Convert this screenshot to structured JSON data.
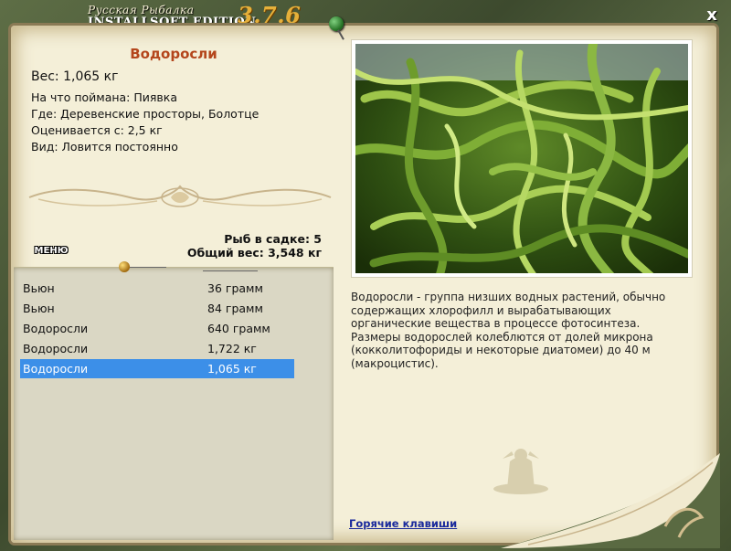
{
  "window": {
    "logo_line1": "Русская Рыбалка",
    "logo_line2": "INSTALLSOFT EDITION",
    "version": "3.7.6",
    "close_label": "x"
  },
  "fish": {
    "name": "Водоросли",
    "weight": "Вес: 1,065 кг",
    "bait": "На что поймана: Пиявка",
    "location": "Где: Деревенские просторы, Болотце",
    "valued_from": "Оценивается с: 2,5 кг",
    "kind": "Вид: Ловится постоянно"
  },
  "cage": {
    "count": "Рыб в садке: 5",
    "total_weight": "Общий вес: 3,548 кг"
  },
  "menu_label": "МЕНЮ",
  "catches": [
    {
      "name": "Вьюн",
      "weight": "36 грамм"
    },
    {
      "name": "Вьюн",
      "weight": "84 грамм"
    },
    {
      "name": "Водоросли",
      "weight": "640 грамм"
    },
    {
      "name": "Водоросли",
      "weight": "1,722 кг"
    },
    {
      "name": "Водоросли",
      "weight": "1,065 кг",
      "selected": true
    }
  ],
  "description": "Водоросли - группа низших водных растений, обычно содержащих хлорофилл и вырабатывающих органические вещества в процессе фотосинтеза. Размеры водорослей колеблются от долей микрона (кокколитофориды и некоторые диатомеи) до 40 м (макроцистис).",
  "hotkeys_link": "Горячие клавиши",
  "colors": {
    "accent_title": "#b4461c",
    "selection": "#3c8fe8",
    "link": "#1a2a9c",
    "parchment": "#f4efd8"
  }
}
